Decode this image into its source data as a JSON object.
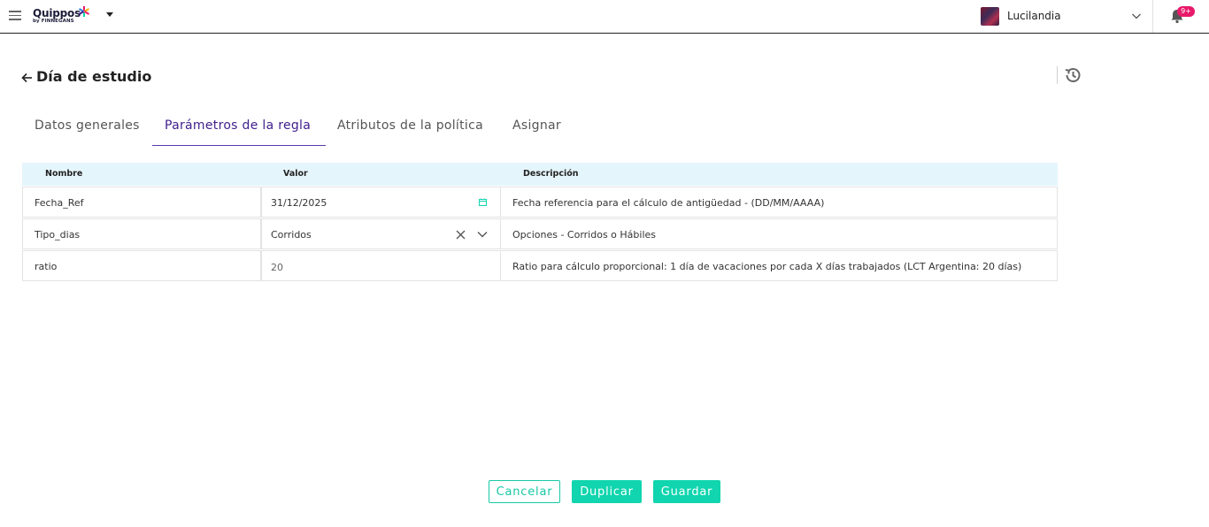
{
  "app": {
    "logo_text": "Quippos",
    "logo_sub": "by FINNEGANS",
    "company_name": "Lucilandia",
    "notification_badge": "9+"
  },
  "page": {
    "title": "Día de estudio"
  },
  "tabs": [
    {
      "label": "Datos generales",
      "active": false
    },
    {
      "label": "Parámetros de la regla",
      "active": true
    },
    {
      "label": "Atributos de la política",
      "active": false
    },
    {
      "label": "Asignar",
      "active": false
    }
  ],
  "table": {
    "headers": {
      "name": "Nombre",
      "value": "Valor",
      "description": "Descripción"
    },
    "rows": [
      {
        "name": "Fecha_Ref",
        "value": "31/12/2025",
        "description": "Fecha referencia para el cálculo de antigüedad - (DD/MM/AAAA)",
        "control": "date"
      },
      {
        "name": "Tipo_dias",
        "value": "Corridos",
        "description": "Opciones - Corridos o Hábiles",
        "control": "select"
      },
      {
        "name": "ratio",
        "value": "20",
        "description": "Ratio para cálculo proporcional: 1 día de vacaciones por cada X días trabajados (LCT Argentina: 20 días)",
        "control": "number"
      }
    ]
  },
  "buttons": {
    "cancel": "Cancelar",
    "duplicate": "Duplicar",
    "save": "Guardar"
  },
  "colors": {
    "accent": "#10d5ae",
    "tab_active": "#3f1e8c",
    "badge": "#e8196a",
    "table_header_bg": "#e5f5fc"
  },
  "icons": [
    "menu-icon",
    "logo-star-icon",
    "caret-down-icon",
    "chevron-down-icon",
    "bell-icon",
    "back-arrow-icon",
    "history-icon",
    "calendar-icon",
    "clear-icon"
  ]
}
